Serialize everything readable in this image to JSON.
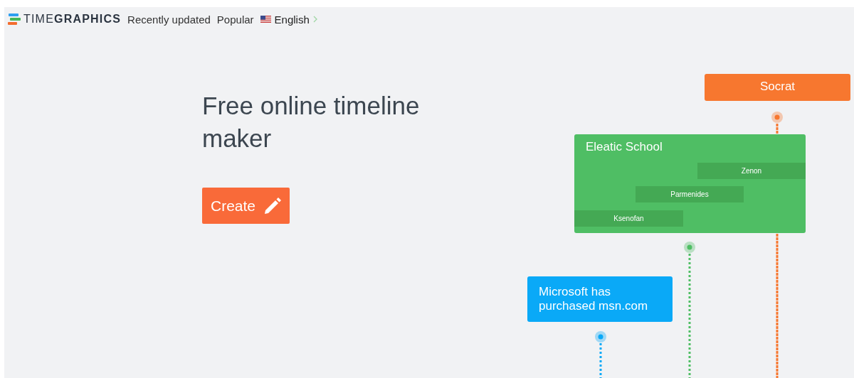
{
  "header": {
    "logo": "TIME**GRAPHICS**",
    "nav": [
      "Recently updated",
      "Popular"
    ],
    "language": "English"
  },
  "hero": {
    "title": "Free online timeline maker",
    "button": "Create"
  },
  "timeline": {
    "events": [
      {
        "title": "Socrat",
        "color": "#f7772f",
        "kind": "period"
      },
      {
        "title": "Eleatic School",
        "color": "#4fbe64",
        "kind": "group",
        "members": [
          "Zenon",
          "Parmenides",
          "Ksenofan"
        ]
      },
      {
        "title": "Microsoft has purchased msn.com",
        "color": "#0aa9f7",
        "kind": "event"
      }
    ]
  }
}
